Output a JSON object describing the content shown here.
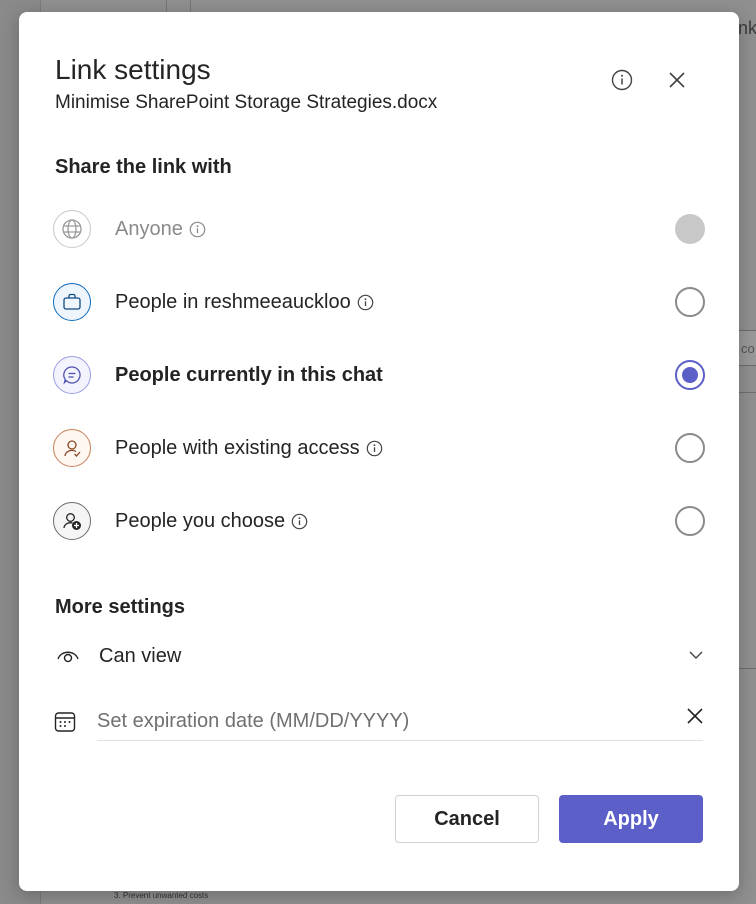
{
  "background": {
    "top_text": "nk",
    "tab_text": "co",
    "bottom_text": "3.   Prevent unwanted costs"
  },
  "dialog": {
    "title": "Link settings",
    "subtitle": "Minimise SharePoint Storage Strategies.docx",
    "info_icon": "info-icon",
    "close_icon": "close-icon"
  },
  "share": {
    "heading": "Share the link with",
    "options": [
      {
        "label": "Anyone",
        "icon": "globe-icon",
        "has_info": true,
        "state": "disabled"
      },
      {
        "label": "People in reshmeeauckloo",
        "icon": "briefcase-icon",
        "has_info": true,
        "state": "unchecked"
      },
      {
        "label": "People currently in this chat",
        "icon": "chat-icon",
        "has_info": false,
        "state": "checked"
      },
      {
        "label": "People with existing access",
        "icon": "person-access-icon",
        "has_info": true,
        "state": "unchecked"
      },
      {
        "label": "People you choose",
        "icon": "person-add-icon",
        "has_info": true,
        "state": "unchecked"
      }
    ]
  },
  "more_settings": {
    "heading": "More settings",
    "permission": {
      "label": "Can view",
      "icon": "eye-icon"
    },
    "expiration": {
      "value": "",
      "placeholder": "Set expiration date (MM/DD/YYYY)",
      "icon": "calendar-icon"
    }
  },
  "footer": {
    "cancel_label": "Cancel",
    "apply_label": "Apply"
  },
  "colors": {
    "accent": "#5b5fc7",
    "text": "#242424",
    "muted": "#8a8a8a"
  }
}
